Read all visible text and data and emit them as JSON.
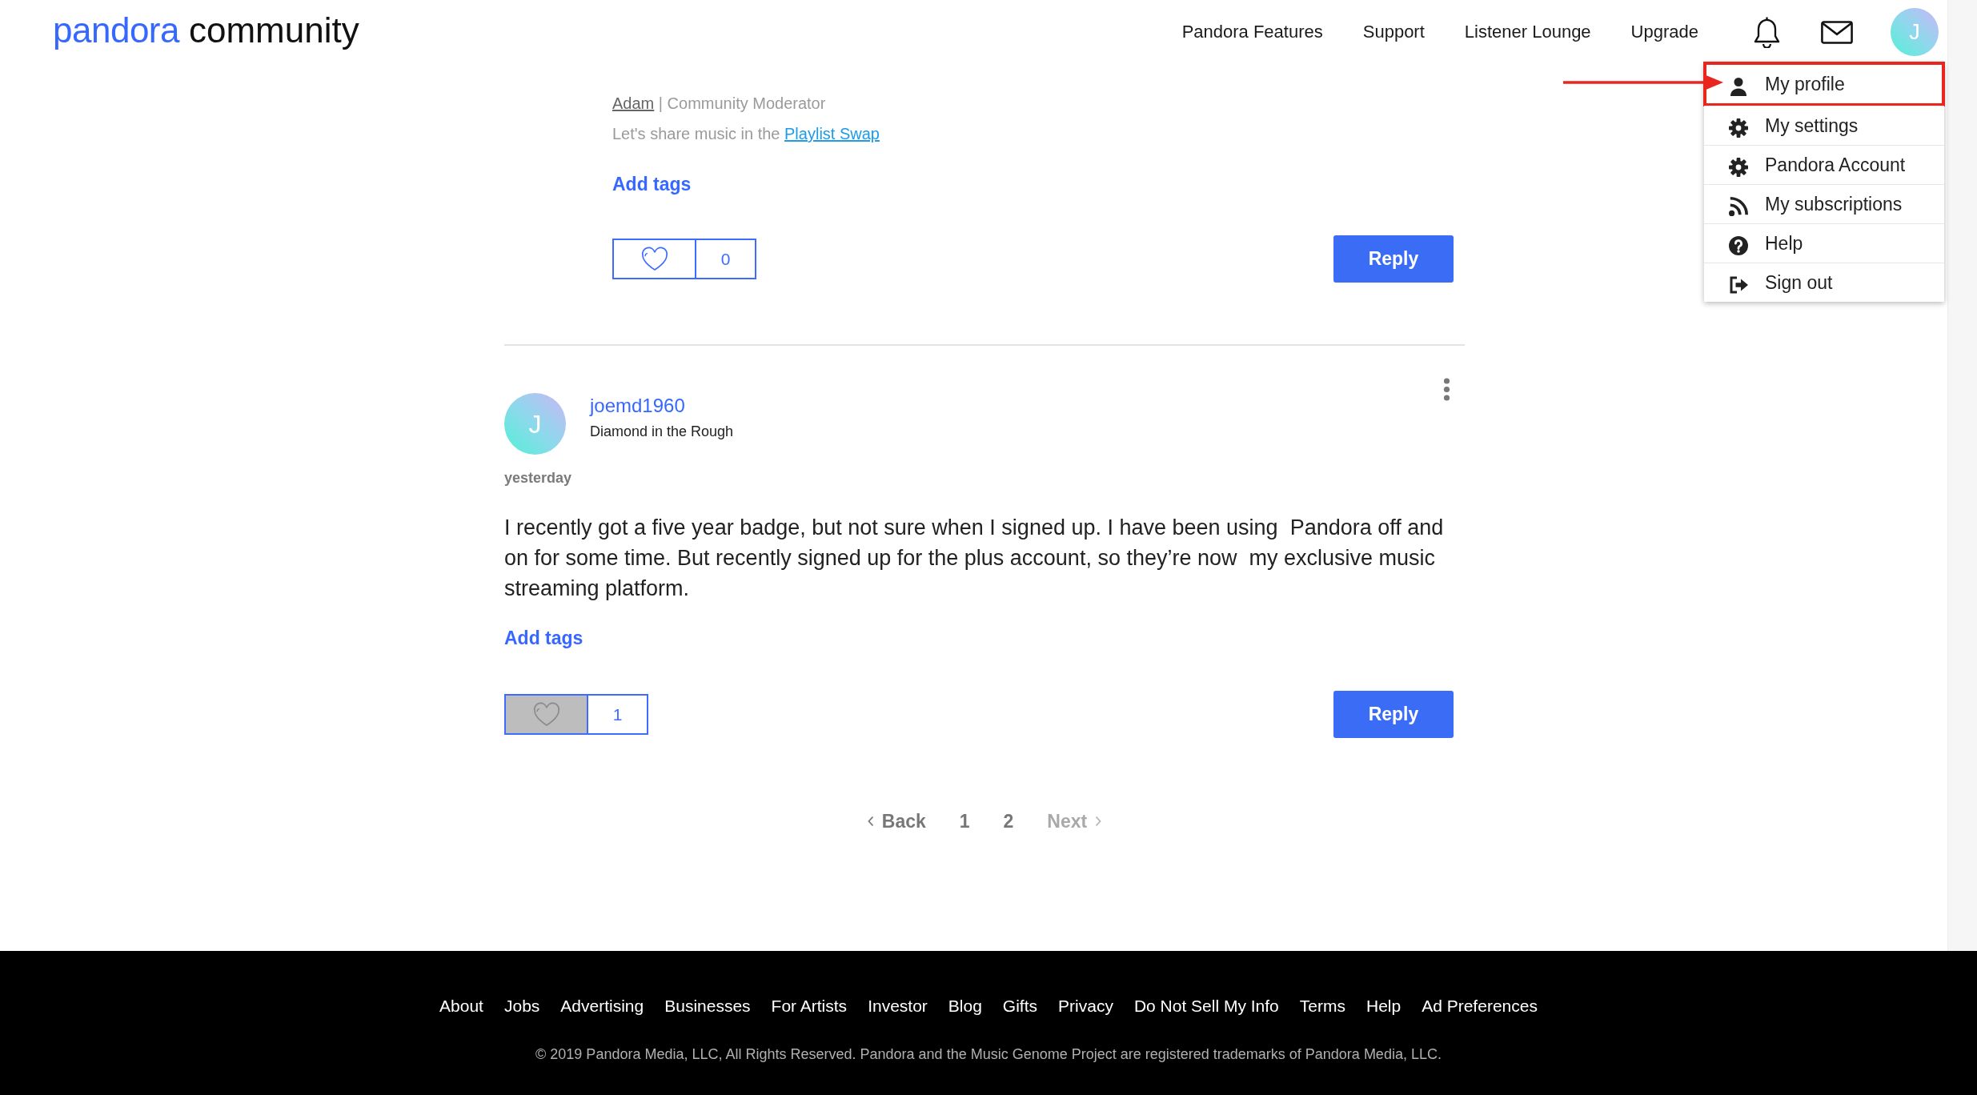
{
  "header": {
    "logo": {
      "brand": "pandora",
      "suffix": "community"
    },
    "nav": [
      {
        "label": "Pandora Features"
      },
      {
        "label": "Support"
      },
      {
        "label": "Listener Lounge"
      },
      {
        "label": "Upgrade"
      }
    ],
    "avatar_initial": "J"
  },
  "user_menu": {
    "items": [
      {
        "label": "My profile",
        "kind": "profile",
        "highlighted": true
      },
      {
        "label": "My settings",
        "kind": "settings",
        "highlighted": false
      },
      {
        "label": "Pandora Account",
        "kind": "account",
        "highlighted": false
      },
      {
        "label": "My subscriptions",
        "kind": "subscriptions",
        "highlighted": false
      },
      {
        "label": "Help",
        "kind": "help",
        "highlighted": false
      },
      {
        "label": "Sign out",
        "kind": "signout",
        "highlighted": false
      }
    ]
  },
  "posts": [
    {
      "kind": "tail",
      "signature": [
        [
          {
            "kind": "user-link",
            "text": "Adam"
          },
          {
            "kind": "text",
            "text": " | Community Moderator"
          }
        ],
        [
          {
            "kind": "text",
            "text": "Let's share music in the "
          },
          {
            "kind": "link",
            "text": "Playlist Swap"
          }
        ]
      ],
      "add_tags": "Add tags",
      "likes": {
        "count": "0",
        "liked": false
      },
      "reply": "Reply"
    },
    {
      "kind": "full",
      "author": {
        "name": "joemd1960",
        "rank": "Diamond in the Rough",
        "initial": "J"
      },
      "time": "yesterday",
      "body": "I recently got a five year badge, but not sure when I signed up. I have been using  Pandora off and on for some time. But recently signed up for the plus account, so they’re now  my exclusive music streaming platform.",
      "add_tags": "Add tags",
      "likes": {
        "count": "1",
        "liked": true
      },
      "reply": "Reply"
    }
  ],
  "pagination": {
    "back": {
      "label": "Back",
      "disabled": false
    },
    "pages": [
      {
        "label": "1"
      },
      {
        "label": "2"
      }
    ],
    "next": {
      "label": "Next",
      "disabled": true
    }
  },
  "footer": {
    "links": [
      "About",
      "Jobs",
      "Advertising",
      "Businesses",
      "For Artists",
      "Investor",
      "Blog",
      "Gifts",
      "Privacy",
      "Do Not Sell My Info",
      "Terms",
      "Help",
      "Ad Preferences"
    ],
    "copyright": "© 2019 Pandora Media, LLC, All Rights Reserved. Pandora and the Music Genome Project are registered trademarks of Pandora Media, LLC."
  }
}
